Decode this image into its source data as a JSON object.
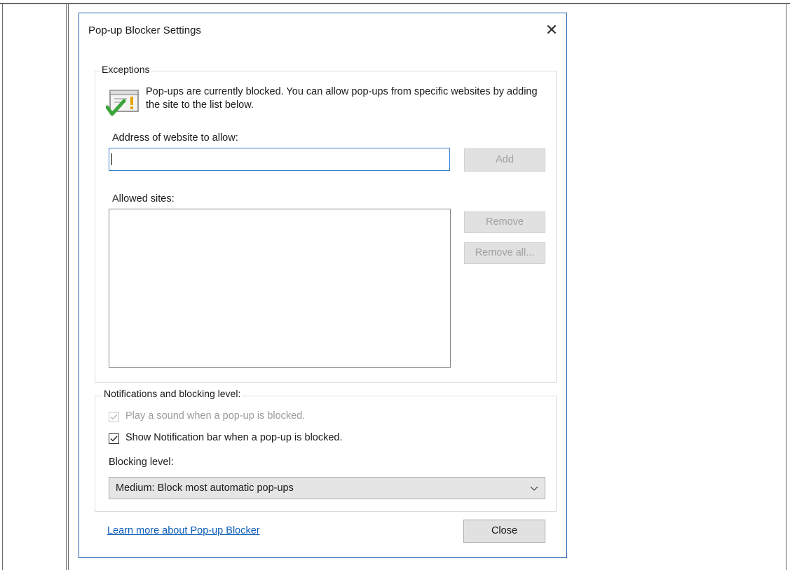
{
  "dialog": {
    "title": "Pop-up Blocker Settings",
    "close_glyph": "✕"
  },
  "exceptions": {
    "legend": "Exceptions",
    "info_text": "Pop-ups are currently blocked.  You can allow pop-ups from specific websites by adding the site to the list below.",
    "icon": "popup-info-icon",
    "address_label": "Address of website to allow:",
    "address_value": "",
    "add_button": "Add",
    "allowed_label": "Allowed sites:",
    "allowed_sites": [],
    "remove_button": "Remove",
    "remove_all_button": "Remove all..."
  },
  "notifications": {
    "legend": "Notifications and blocking level:",
    "play_sound": {
      "label": "Play a sound when a pop-up is blocked.",
      "checked": true,
      "disabled": true
    },
    "show_bar": {
      "label": "Show Notification bar when a pop-up is blocked.",
      "checked": true,
      "disabled": false
    },
    "blocking_label": "Blocking level:",
    "blocking_value": "Medium: Block most automatic pop-ups"
  },
  "footer": {
    "learn_more": "Learn more about Pop-up Blocker",
    "close_button": "Close"
  },
  "colors": {
    "dialog_border": "#1e5ea8",
    "input_focus_border": "#3a7fd1",
    "link": "#0a5cb8",
    "disabled_text": "#a0a0a0",
    "check_green": "#3aa53a"
  }
}
